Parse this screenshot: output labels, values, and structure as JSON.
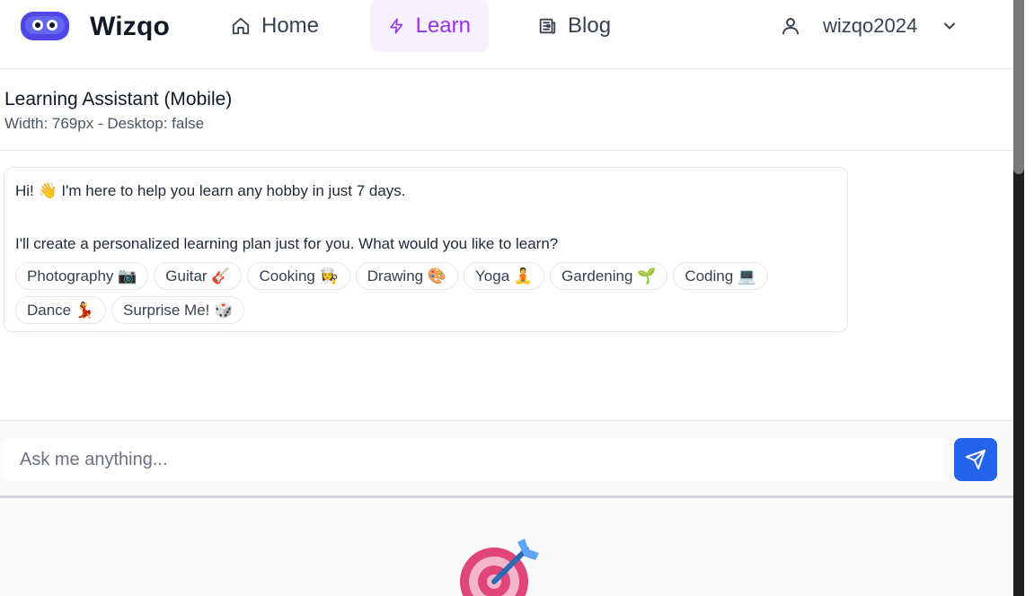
{
  "navbar": {
    "brand": "Wizqo",
    "items": [
      {
        "label": "Home",
        "icon": "home-icon"
      },
      {
        "label": "Learn",
        "icon": "bolt-icon",
        "active": true
      },
      {
        "label": "Blog",
        "icon": "newspaper-icon"
      }
    ],
    "username": "wizqo2024",
    "accent": "#9333ea"
  },
  "assistant": {
    "title": "Learning Assistant (Mobile)",
    "subtitle": "Width: 769px - Desktop: false"
  },
  "chat": {
    "message_line1": "Hi! 👋 I'm here to help you learn any hobby in just 7 days.",
    "message_line2": "I'll create a personalized learning plan just for you. What would you like to learn?",
    "chips": [
      "Photography 📷",
      "Guitar 🎸",
      "Cooking 👩‍🍳",
      "Drawing 🎨",
      "Yoga 🧘",
      "Gardening 🌱",
      "Coding 💻",
      "Dance 💃",
      "Surprise Me! 🎲"
    ]
  },
  "input": {
    "placeholder": "Ask me anything...",
    "send_color": "#2563eb"
  }
}
